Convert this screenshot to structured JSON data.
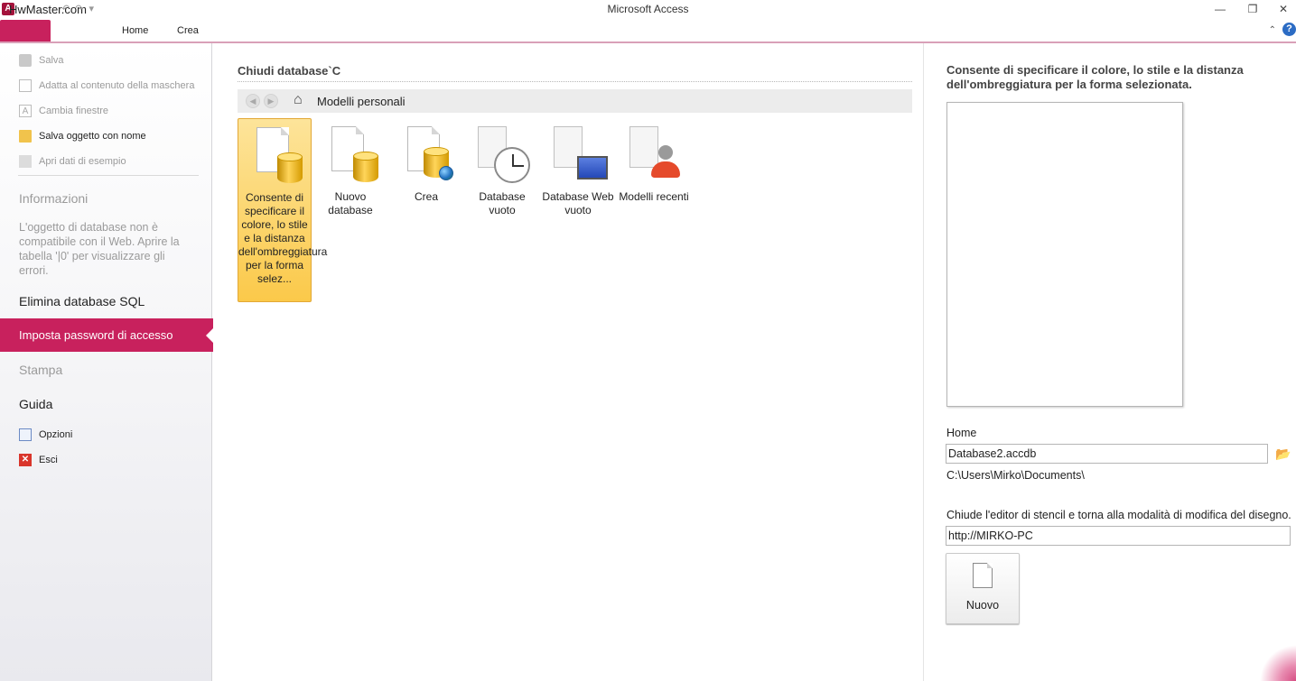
{
  "window": {
    "app_icon": "A",
    "watermark": "HwMaster.com",
    "title": "Microsoft Access"
  },
  "ribbon": {
    "tabs": [
      "Home",
      "Crea"
    ]
  },
  "leftnav": {
    "commands": [
      {
        "label": "Salva",
        "icon": "save-icon",
        "enabled": false
      },
      {
        "label": "Adatta al contenuto della maschera",
        "icon": "fit-icon",
        "enabled": false
      },
      {
        "label": "Cambia finestre",
        "icon": "switch-windows-icon",
        "enabled": false
      },
      {
        "label": "Salva oggetto con nome",
        "icon": "folder-open-icon",
        "enabled": true
      },
      {
        "label": "Apri dati di esempio",
        "icon": "sample-data-icon",
        "enabled": false
      }
    ],
    "informazioni": "Informazioni",
    "info_desc": "L'oggetto di database non è compatibile con il Web. Aprire la tabella '|0' per visualizzare gli errori.",
    "elimina": "Elimina database SQL",
    "selected": "Imposta password di accesso",
    "stampa": "Stampa",
    "guida": "Guida",
    "opzioni": "Opzioni",
    "esci": "Esci"
  },
  "middle": {
    "title": "Chiudi database`C",
    "breadcrumb": "Modelli personali",
    "tiles": [
      {
        "label": "Consente di specificare il colore, lo stile e la distanza dell'ombreggiatura per la forma selez...",
        "selected": true
      },
      {
        "label": "Nuovo database"
      },
      {
        "label": "Crea"
      },
      {
        "label": "Database vuoto"
      },
      {
        "label": "Database Web vuoto"
      },
      {
        "label": "Modelli recenti"
      }
    ]
  },
  "right": {
    "title": "Consente di specificare il colore, lo stile e la distanza dell'ombreggiatura per la forma selezionata.",
    "file_label": "Home",
    "file_name": "Database2.accdb",
    "path": "C:\\Users\\Mirko\\Documents\\",
    "server_label": "Chiude l'editor di stencil e torna alla modalità di modifica del disegno.",
    "server_value": "http://MIRKO-PC",
    "new_button": "Nuovo"
  },
  "colors": {
    "accent": "#c8215d",
    "tile_selected": "#fbc94a"
  }
}
